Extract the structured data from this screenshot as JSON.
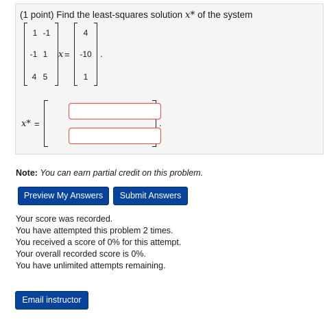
{
  "problem": {
    "points": "(1 point)",
    "statement": "Find the least-squares solution",
    "variable": "x*",
    "statement_tail": "of the system",
    "matrix_a": [
      [
        "1",
        "-1"
      ],
      [
        "-1",
        "1"
      ],
      [
        "4",
        "5"
      ]
    ],
    "x_symbol": "x",
    "equals": "=",
    "vector_b": [
      "4",
      "-10",
      "1"
    ],
    "period": ".",
    "answer_label": "x*",
    "answer_equals": "=",
    "answer_values": [
      "",
      ""
    ],
    "answer_period": "."
  },
  "note": {
    "label": "Note:",
    "text": "You can earn partial credit on this problem."
  },
  "buttons": {
    "preview": "Preview My Answers",
    "submit": "Submit Answers",
    "email": "Email instructor"
  },
  "status": [
    "Your score was recorded.",
    "You have attempted this problem 2 times.",
    "You received a score of 0% for this attempt.",
    "Your overall recorded score is 0%.",
    "You have unlimited attempts remaining."
  ]
}
